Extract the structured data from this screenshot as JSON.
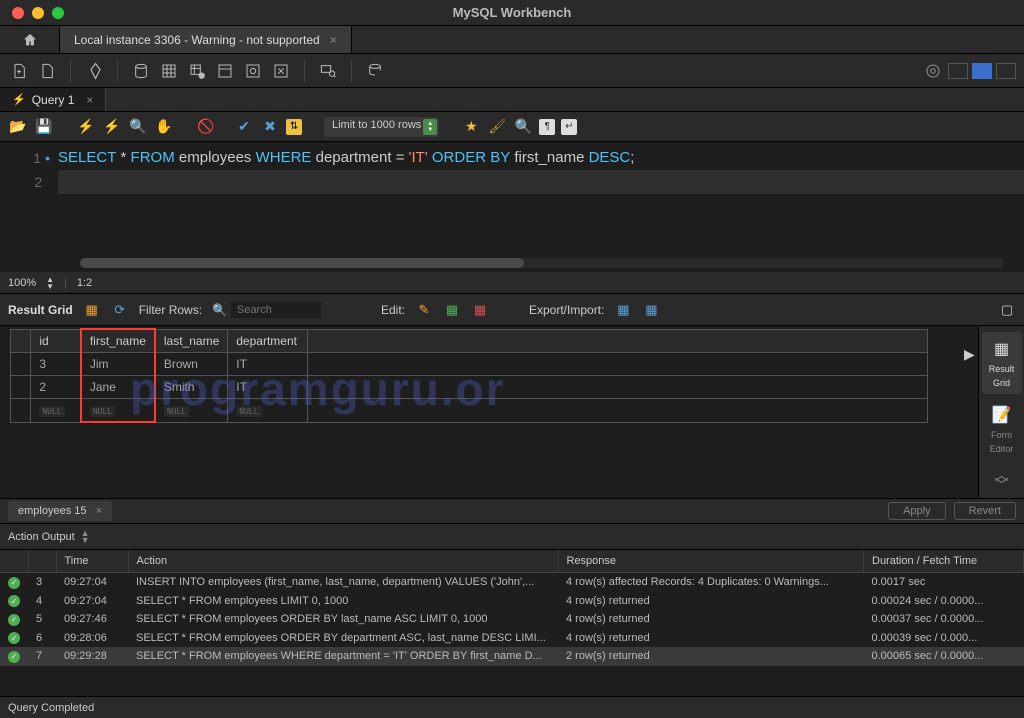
{
  "app_title": "MySQL Workbench",
  "connection_tab": "Local instance 3306 - Warning - not supported",
  "query_tab": "Query 1",
  "limit_label": "Limit to 1000 rows",
  "zoom": {
    "percent": "100%",
    "pos": "1:2"
  },
  "sql": {
    "tokens": [
      {
        "t": "kw",
        "v": "SELECT"
      },
      {
        "t": "sp",
        "v": " "
      },
      {
        "t": "op",
        "v": "*"
      },
      {
        "t": "sp",
        "v": " "
      },
      {
        "t": "kw",
        "v": "FROM"
      },
      {
        "t": "sp",
        "v": " "
      },
      {
        "t": "id",
        "v": "employees"
      },
      {
        "t": "sp",
        "v": " "
      },
      {
        "t": "kw",
        "v": "WHERE"
      },
      {
        "t": "sp",
        "v": " "
      },
      {
        "t": "id",
        "v": "department"
      },
      {
        "t": "sp",
        "v": " "
      },
      {
        "t": "op",
        "v": "="
      },
      {
        "t": "sp",
        "v": " "
      },
      {
        "t": "str",
        "v": "'IT'"
      },
      {
        "t": "sp",
        "v": " "
      },
      {
        "t": "kw",
        "v": "ORDER"
      },
      {
        "t": "sp",
        "v": " "
      },
      {
        "t": "kw",
        "v": "BY"
      },
      {
        "t": "sp",
        "v": " "
      },
      {
        "t": "id",
        "v": "first_name"
      },
      {
        "t": "sp",
        "v": " "
      },
      {
        "t": "kw",
        "v": "DESC"
      },
      {
        "t": "op",
        "v": ";"
      }
    ]
  },
  "result_toolbar": {
    "label": "Result Grid",
    "filter_label": "Filter Rows:",
    "search_placeholder": "Search",
    "edit_label": "Edit:",
    "export_label": "Export/Import:"
  },
  "result": {
    "columns": [
      "id",
      "first_name",
      "last_name",
      "department"
    ],
    "rows": [
      {
        "id": "3",
        "first_name": "Jim",
        "last_name": "Brown",
        "department": "IT"
      },
      {
        "id": "2",
        "first_name": "Jane",
        "last_name": "Smith",
        "department": "IT"
      }
    ],
    "highlight_column": "first_name"
  },
  "side_tabs": [
    {
      "label": "Result Grid",
      "active": true
    },
    {
      "label": "Form Editor",
      "active": false
    }
  ],
  "result_tab_label": "employees 15",
  "apply_label": "Apply",
  "revert_label": "Revert",
  "action_output_label": "Action Output",
  "action_columns": [
    "",
    "",
    "Time",
    "Action",
    "Response",
    "Duration / Fetch Time"
  ],
  "actions": [
    {
      "n": "3",
      "time": "09:27:04",
      "action": "INSERT INTO employees (first_name, last_name, department) VALUES ('John',...",
      "response": "4 row(s) affected Records: 4  Duplicates: 0  Warnings...",
      "duration": "0.0017 sec"
    },
    {
      "n": "4",
      "time": "09:27:04",
      "action": "SELECT * FROM employees LIMIT 0, 1000",
      "response": "4 row(s) returned",
      "duration": "0.00024 sec / 0.0000..."
    },
    {
      "n": "5",
      "time": "09:27:46",
      "action": "SELECT * FROM employees ORDER BY last_name ASC LIMIT 0, 1000",
      "response": "4 row(s) returned",
      "duration": "0.00037 sec / 0.0000..."
    },
    {
      "n": "6",
      "time": "09:28:06",
      "action": "SELECT * FROM employees ORDER BY department ASC, last_name DESC LIMI...",
      "response": "4 row(s) returned",
      "duration": "0.00039 sec / 0.000..."
    },
    {
      "n": "7",
      "time": "09:29:28",
      "action": "SELECT * FROM employees WHERE department = 'IT' ORDER BY first_name D...",
      "response": "2 row(s) returned",
      "duration": "0.00065 sec / 0.0000..."
    }
  ],
  "status_text": "Query Completed",
  "watermark": "programguru.or"
}
